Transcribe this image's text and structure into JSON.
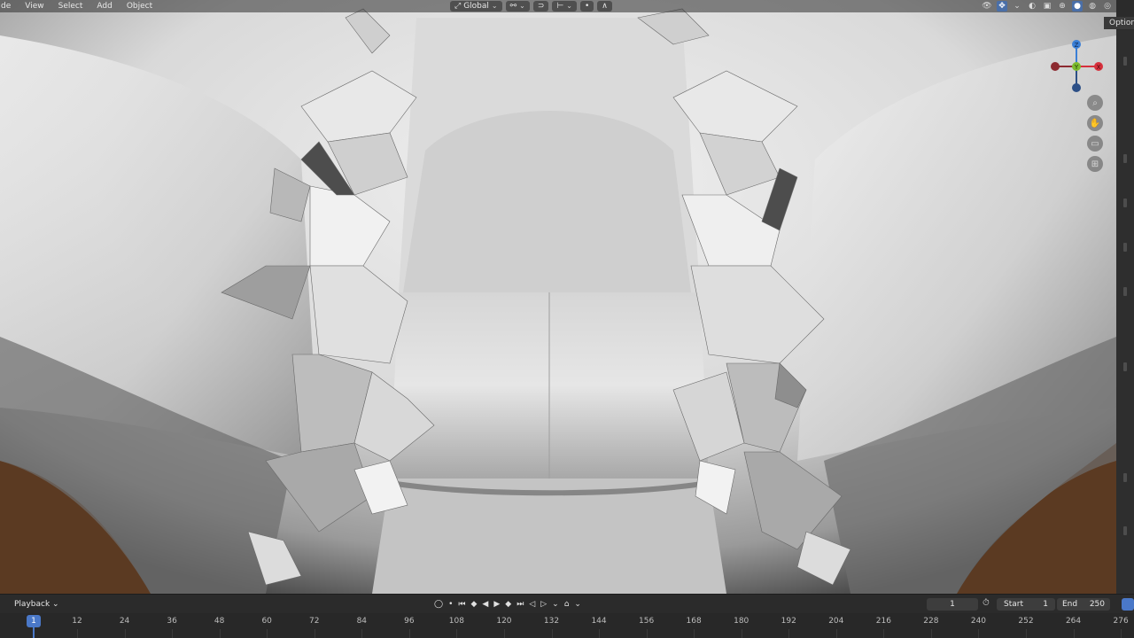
{
  "header": {
    "menu": [
      "de",
      "View",
      "Select",
      "Add",
      "Object"
    ],
    "transform_orientation": "Global",
    "options_tab": "Options"
  },
  "gizmo": {
    "axes": [
      "Z",
      "Y",
      "X"
    ],
    "colors": {
      "x": "#d6303c",
      "y": "#7dbb2e",
      "z": "#3a7fd6"
    }
  },
  "nav_icons": [
    "zoom-icon",
    "pan-hand-icon",
    "camera-icon",
    "grid-icon"
  ],
  "timeline": {
    "playback_label": "Playback",
    "current_frame": "1",
    "start_label": "Start",
    "start_value": "1",
    "end_label": "End",
    "end_value": "250",
    "ruler_ticks": [
      "1",
      "12",
      "24",
      "36",
      "48",
      "60",
      "72",
      "84",
      "96",
      "108",
      "120",
      "132",
      "144",
      "156",
      "168",
      "180",
      "192",
      "204",
      "216",
      "228",
      "240",
      "252",
      "264",
      "276"
    ]
  },
  "colors": {
    "accent": "#4a78c8",
    "background_brown": "#5b3a22"
  }
}
